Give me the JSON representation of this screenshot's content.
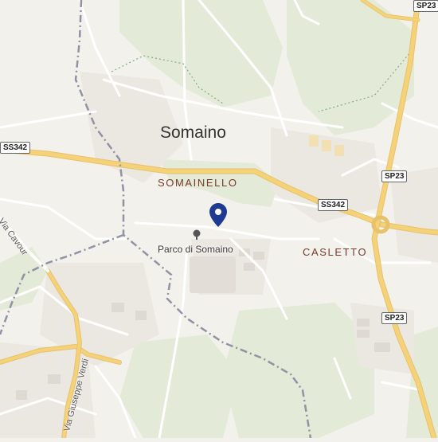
{
  "map": {
    "places": {
      "town": "Somaino",
      "hamlet_1": "SOMAINELLO",
      "hamlet_2": "CASLETTO",
      "park": "Parco di Somaino"
    },
    "streets": {
      "cavour": "Via Cavour",
      "verdi": "Via Giuseppe Verdi"
    },
    "road_shields": {
      "ss342_west": "SS342",
      "ss342_east": "SS342",
      "sp23_top": "SP23",
      "sp23_mid": "SP23",
      "sp23_low": "SP23"
    },
    "icons": {
      "marker": "location-pin-icon",
      "park": "tree-icon"
    },
    "colors": {
      "background": "#f3f1ec",
      "main_road": "#f5d27a",
      "minor_road": "#ffffff",
      "green": "#e3ead7",
      "boundary": "#8f93a3",
      "marker": "#1f3a93"
    }
  }
}
